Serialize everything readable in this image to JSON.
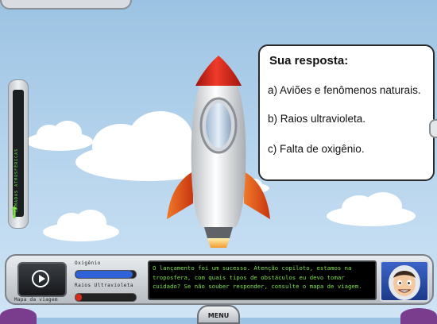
{
  "question_panel": {
    "title": "Sua resposta:",
    "options": [
      "a) Aviões e  fenômenos naturais.",
      "b) Raios ultravioleta.",
      "c) Falta de oxigênio."
    ]
  },
  "side_gauge": {
    "label": "CAMADAS ATMOSFÉRICAS"
  },
  "hud": {
    "map_label": "Mapa da viagem",
    "oxygen_label": "Oxigênio",
    "oxygen_level": 0.95,
    "oxygen_color": "#2f62d6",
    "uv_label": "Raios Ultravioleta",
    "uv_level": 0.1,
    "uv_color": "#d42a1a",
    "message": "O lançamento foi um sucesso. Atenção copiloto, estamos na troposfera, com quais tipos de obstáculos eu devo tomar cuidado? Se não souber responder, consulte o mapa de viagem."
  },
  "menu": {
    "label": "MENU"
  },
  "colors": {
    "sky": "#a9cbe8",
    "message_text": "#7ee04a",
    "rocket_nose": "#d8261b",
    "rocket_body": "#e8eaec"
  }
}
